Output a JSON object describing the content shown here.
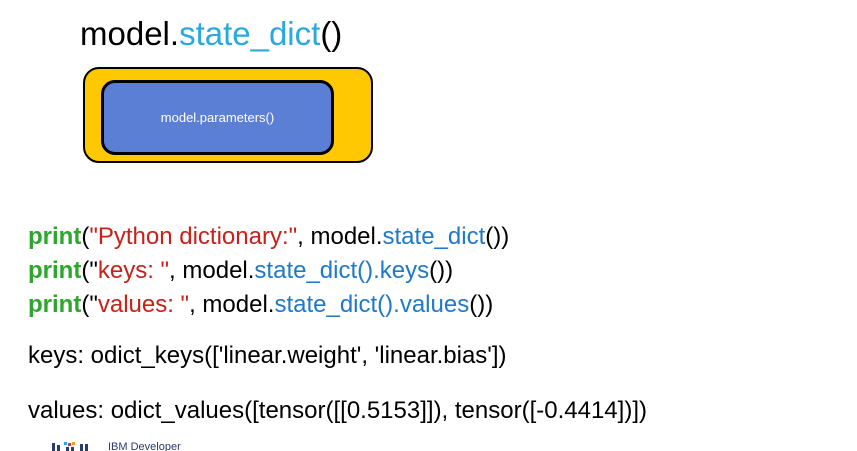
{
  "title": {
    "prefix": "model.",
    "method": "state_dict",
    "parens": "()"
  },
  "diagram": {
    "inner_label": "model.parameters()",
    "outer_color": "#ffc800",
    "inner_color": "#5a7fd4"
  },
  "code": {
    "line1": {
      "keyword": "print",
      "open": "(",
      "string": "\"Python dictionary:\"",
      "sep": ", model.",
      "method": "state_dict",
      "close": "())"
    },
    "line2": {
      "keyword": "print",
      "open": "(\"",
      "string": "keys: \"",
      "sep": ", model.",
      "method": "state_dict().keys",
      "close": "())"
    },
    "line3": {
      "keyword": "print",
      "open": "(\"",
      "string": "values: \"",
      "sep": ", model.",
      "method": "state_dict().values",
      "close": "())"
    }
  },
  "output": {
    "keys_line": "keys: odict_keys(['linear.weight', 'linear.bias'])",
    "values_line": "values: odict_values([tensor([[0.5153]]), tensor([-0.4414])])"
  },
  "footer": {
    "brand": "IBM Developer"
  },
  "colors": {
    "keyword": "#2ea62e",
    "string": "#c8201a",
    "method": "#1f78c8",
    "title_method": "#2aa8e0"
  }
}
